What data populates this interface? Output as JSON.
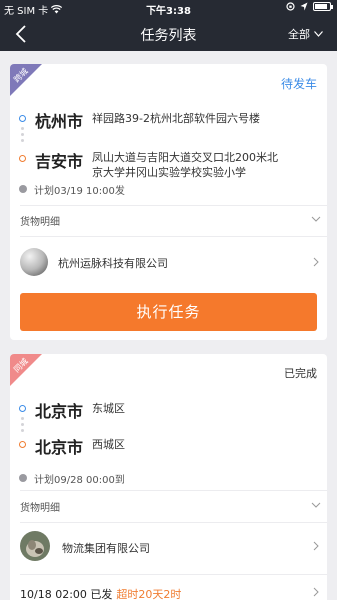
{
  "status_bar": {
    "carrier": "无 SIM 卡",
    "time": "下午3:38",
    "battery_level": 0.85
  },
  "nav": {
    "title": "任务列表",
    "filter_label": "全部"
  },
  "tasks": [
    {
      "tag": "跨城",
      "tag_color": "#7f79b9",
      "status": "待发车",
      "from_city": "杭州市",
      "from_addr": "祥园路39-2杭州北部软件园六号楼",
      "to_city": "吉安市",
      "to_addr_line1": "凤山大道与吉阳大道交叉口北200米北",
      "to_addr_line2": "京大学井冈山实验学校实验小学",
      "plan": "计划03/19 10:00发",
      "goods_label": "货物明细",
      "company": "杭州运脉科技有限公司",
      "action": "执行任务"
    },
    {
      "tag": "同城",
      "tag_color": "#f08a8a",
      "status": "已完成",
      "from_city": "北京市",
      "from_addr": "东城区",
      "to_city": "北京市",
      "to_addr": "西城区",
      "plan": "计划09/28 00:00到",
      "goods_label": "货物明细",
      "company": "物流集团有限公司",
      "depart": "10/18  02:00 已发",
      "overdue": "超时20天2时"
    }
  ],
  "colors": {
    "accent_blue": "#3c8ce7",
    "accent_orange": "#f5792c",
    "nav_bg": "#262a33"
  }
}
